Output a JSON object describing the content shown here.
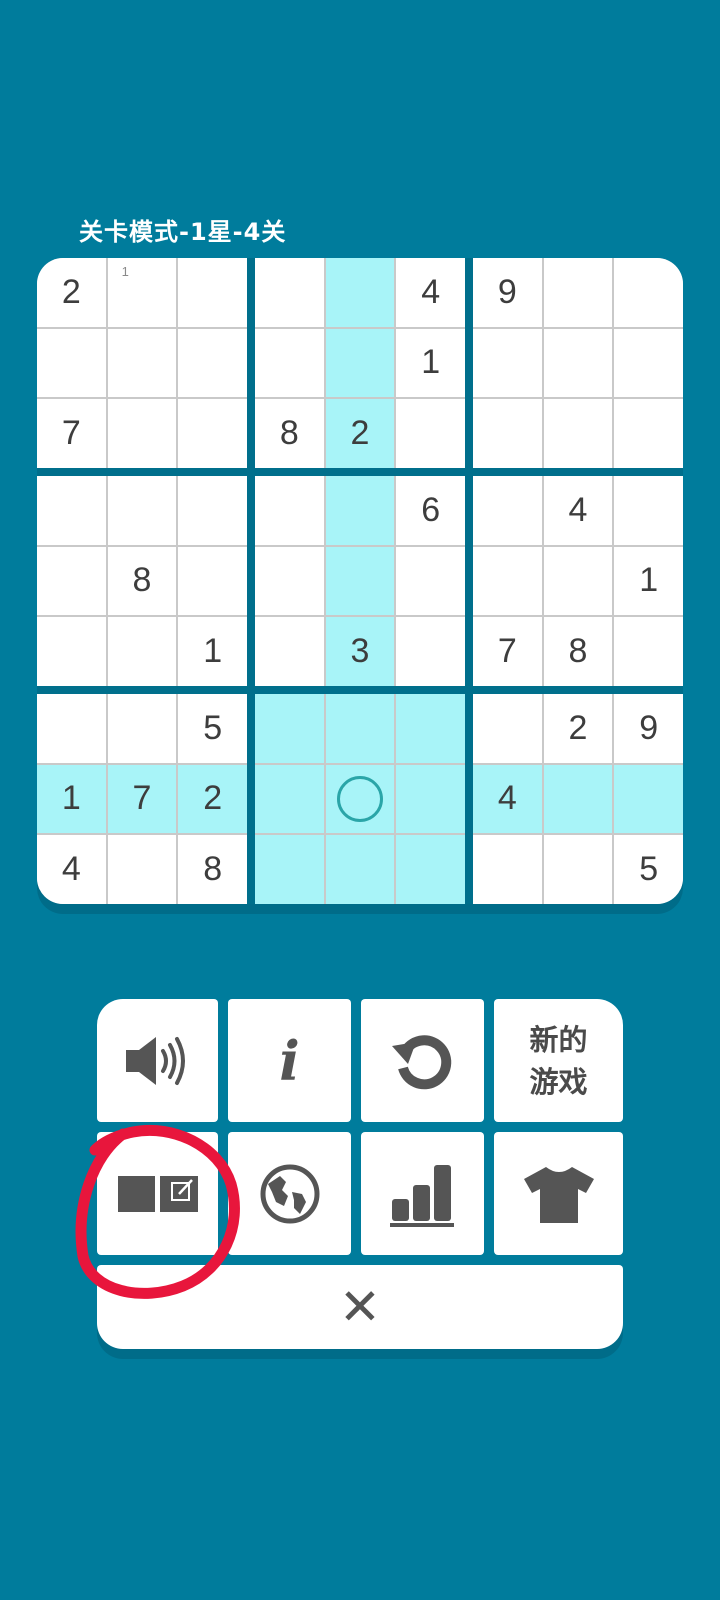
{
  "header": {
    "level_title": "关卡模式-1星-4关"
  },
  "board": {
    "cells": [
      [
        "2",
        "",
        "",
        "",
        "",
        "4",
        "9",
        "",
        ""
      ],
      [
        "",
        "",
        "",
        "",
        "",
        "1",
        "",
        "",
        ""
      ],
      [
        "7",
        "",
        "",
        "8",
        "2",
        "",
        "",
        "",
        ""
      ],
      [
        "",
        "",
        "",
        "",
        "",
        "6",
        "",
        "4",
        ""
      ],
      [
        "",
        "8",
        "",
        "",
        "",
        "",
        "",
        "",
        "1"
      ],
      [
        "",
        "",
        "1",
        "",
        "3",
        "",
        "7",
        "8",
        ""
      ],
      [
        "",
        "",
        "5",
        "",
        "",
        "",
        "",
        "2",
        "9"
      ],
      [
        "1",
        "7",
        "2",
        "",
        "",
        "",
        "4",
        "",
        ""
      ],
      [
        "4",
        "",
        "8",
        "",
        "",
        "",
        "",
        "",
        "5"
      ]
    ],
    "notes": [
      {
        "row": 0,
        "col": 1,
        "text": "1"
      }
    ],
    "selected": {
      "row": 7,
      "col": 4
    },
    "highlight_color": "#a8f4f8"
  },
  "menu": {
    "new_game_label": "新的\n游戏",
    "info_label": "i",
    "close_label": "✕",
    "icons": {
      "sound": "speaker-icon",
      "info": "info-icon",
      "restart": "restart-icon",
      "notes": "notes-mode-icon",
      "language": "globe-icon",
      "stats": "stats-chart-icon",
      "theme": "tshirt-icon"
    }
  },
  "colors": {
    "background": "#007c9c",
    "cell_text": "#3d3d3d",
    "icon": "#555555",
    "annotation": "#e8163c"
  }
}
